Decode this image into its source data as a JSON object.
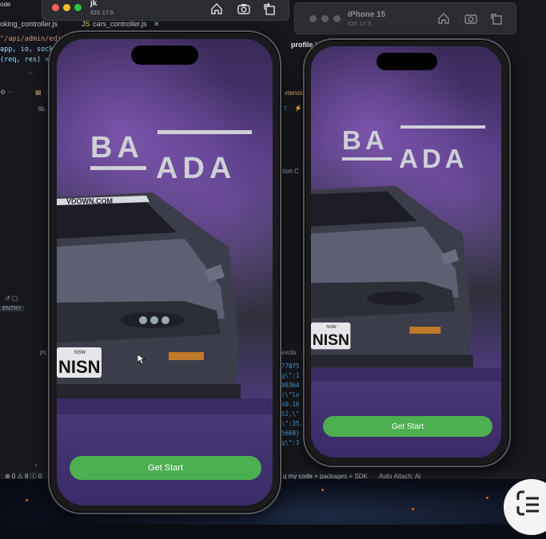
{
  "ide": {
    "top_left_label": "ode",
    "tab_left": "oking_controller.js",
    "tab_cars": "cars_controller.js",
    "tab_cars_prefix": "JS",
    "code_route": "\"/api/admin/edit_",
    "code_line2": "app, io, socke",
    "code_line3": "(req, res) =",
    "file_profile": "profile.jpe",
    "ext_label": "xtensio",
    "side_lib": "lib",
    "side_on": "tion C",
    "debug_entry": "ENTRY",
    "side_pr": "PI",
    "console_lines": [
      "77075",
      "g\\\":1",
      "80364",
      "(\\\"lo",
      "40.16",
      "52,\\\"",
      "\\\":35.",
      "5669}",
      "g\\\":3"
    ],
    "side_exclu": "exclu",
    "status_left": "⊗ 0 ⚠ 8 ⓘ 0",
    "status_right": "g my code + packages + SDK",
    "status_attach": "Auto Attach: Al"
  },
  "simulators": [
    {
      "title": "jk",
      "subtitle": "iOS 17.5",
      "buttons": [
        "home-icon",
        "screenshot-icon",
        "rotate-icon"
      ]
    },
    {
      "title": "iPhone 15",
      "subtitle": "iOS 17.5",
      "buttons": [
        "home-icon",
        "screenshot-icon",
        "rotate-icon"
      ]
    }
  ],
  "app": {
    "logo_line1": "BA",
    "logo_line2": "ADA",
    "windshield_banner": "VDOWN.COM",
    "plate_top": "NSW",
    "plate_text": "NISN",
    "cta_label": "Get Start"
  },
  "colors": {
    "cta": "#4caf50",
    "traffic_red": "#ff5f57",
    "traffic_yellow": "#febc2e",
    "traffic_green": "#28c840"
  }
}
